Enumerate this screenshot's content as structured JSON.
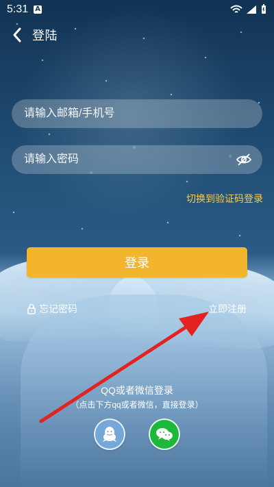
{
  "status_bar": {
    "time": "5:31",
    "app_indicator": "A"
  },
  "header": {
    "back_icon": "back-chevron-icon",
    "title": "登陆"
  },
  "form": {
    "account_placeholder": "请输入邮箱/手机号",
    "password_placeholder": "请输入密码",
    "eye_icon": "eye-hidden-icon",
    "switch_to_code_login": "切换到验证码登录",
    "login_button": "登录",
    "forgot_password": "忘记密码",
    "register": "立即注册"
  },
  "social": {
    "title": "QQ或者微信登录",
    "subtitle": "（点击下方qq或者微信，直接登录）",
    "qq_icon": "qq-icon",
    "wechat_icon": "wechat-icon"
  },
  "colors": {
    "accent": "#f3b52d",
    "link_accent": "#ffcc45",
    "annotation_arrow": "#e32222",
    "wechat": "#1db83a",
    "qq": "#75a7d8"
  }
}
